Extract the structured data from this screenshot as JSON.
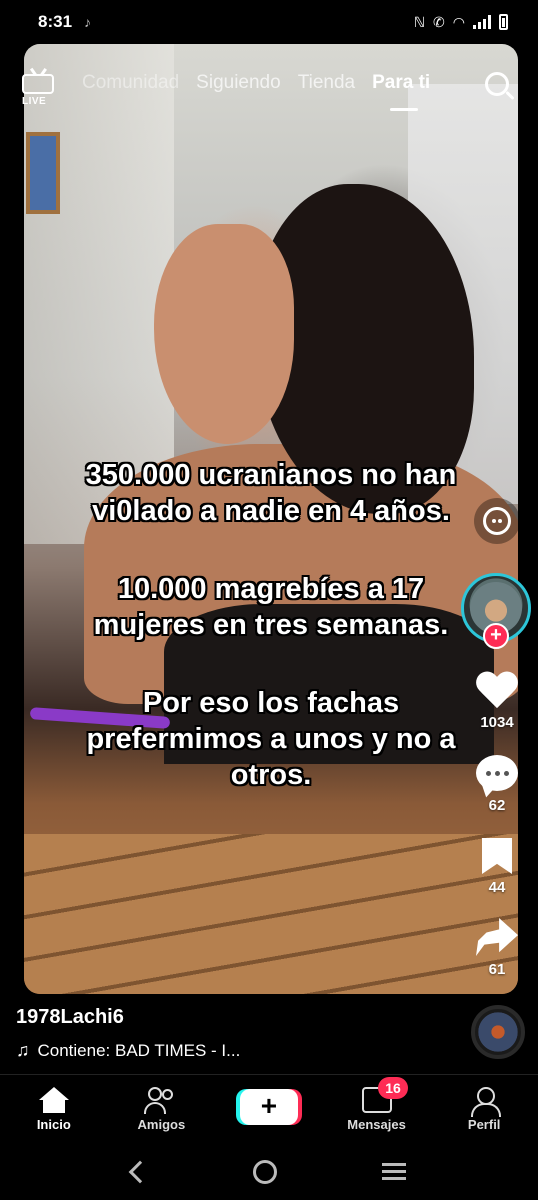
{
  "status_bar": {
    "time": "8:31",
    "indicators": [
      "nfc-icon",
      "wifi-call-icon",
      "wifi-icon",
      "signal-icon",
      "battery-icon"
    ]
  },
  "top_nav": {
    "live_label": "LIVE",
    "tabs": [
      {
        "label": "Comunidad",
        "active": false
      },
      {
        "label": "Siguiendo",
        "active": false
      },
      {
        "label": "Tienda",
        "active": false
      },
      {
        "label": "Para ti",
        "active": true
      }
    ]
  },
  "video": {
    "caption_lines": [
      "350.000 ucranianos no han\nvi0lado a nadie en 4 años.",
      "10.000 magrebíes a 17\nmujeres en tres semanas.",
      "Por eso los fachas\nprefermimos a unos y no a\notros."
    ]
  },
  "rail": {
    "follow_symbol": "+",
    "likes": "1034",
    "comments": "62",
    "saves": "44",
    "shares": "61"
  },
  "post": {
    "username": "1978Lachi6",
    "music": "Contiene: BAD TIMES - I..."
  },
  "bottom_nav": {
    "items": [
      {
        "label": "Inicio",
        "active": true
      },
      {
        "label": "Amigos",
        "active": false
      },
      {
        "label": "",
        "active": false
      },
      {
        "label": "Mensajes",
        "active": false
      },
      {
        "label": "Perfil",
        "active": false
      }
    ],
    "create_symbol": "+",
    "inbox_badge": "16"
  },
  "colors": {
    "accent_red": "#fe2c55",
    "accent_cyan": "#25f4ee",
    "avatar_ring": "#2dc6d9"
  }
}
